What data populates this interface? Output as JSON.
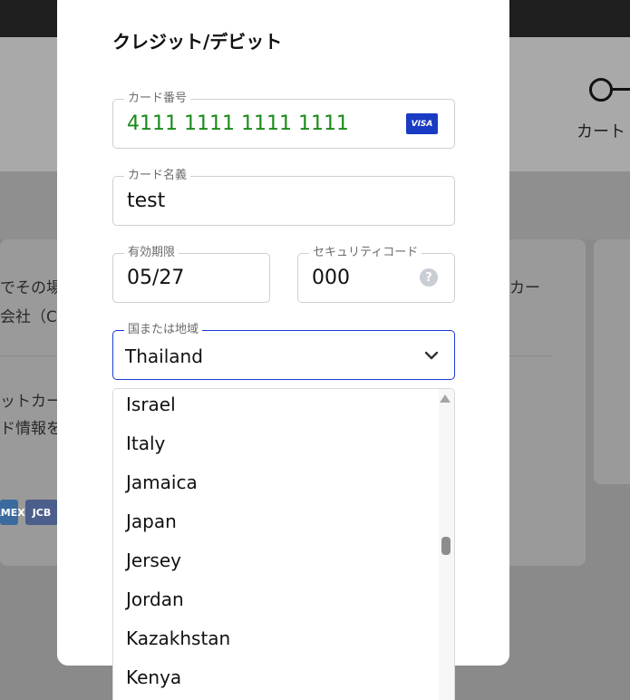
{
  "background": {
    "step_label": "カート",
    "text_rows": [
      "でその場",
      "カー",
      "会社（C",
      "ットカー",
      "ド情報を"
    ],
    "brands": [
      "AMEX",
      "JCB"
    ]
  },
  "modal": {
    "title": "クレジット/デビット",
    "card_number": {
      "label": "カード番号",
      "value": "4111 1111 1111 1111",
      "brand": "VISA",
      "color": "#1a8a1a"
    },
    "card_name": {
      "label": "カード名義",
      "value": "test"
    },
    "expiry": {
      "label": "有効期限",
      "value": "05/27"
    },
    "cvc": {
      "label": "セキュリティコード",
      "value": "000",
      "help": "?"
    },
    "country": {
      "label": "国または地域",
      "value": "Thailand"
    },
    "country_options": [
      "Israel",
      "Italy",
      "Jamaica",
      "Japan",
      "Jersey",
      "Jordan",
      "Kazakhstan",
      "Kenya"
    ]
  },
  "colors": {
    "focus": "#1a3bd6",
    "visa": "#1a3bc4"
  }
}
